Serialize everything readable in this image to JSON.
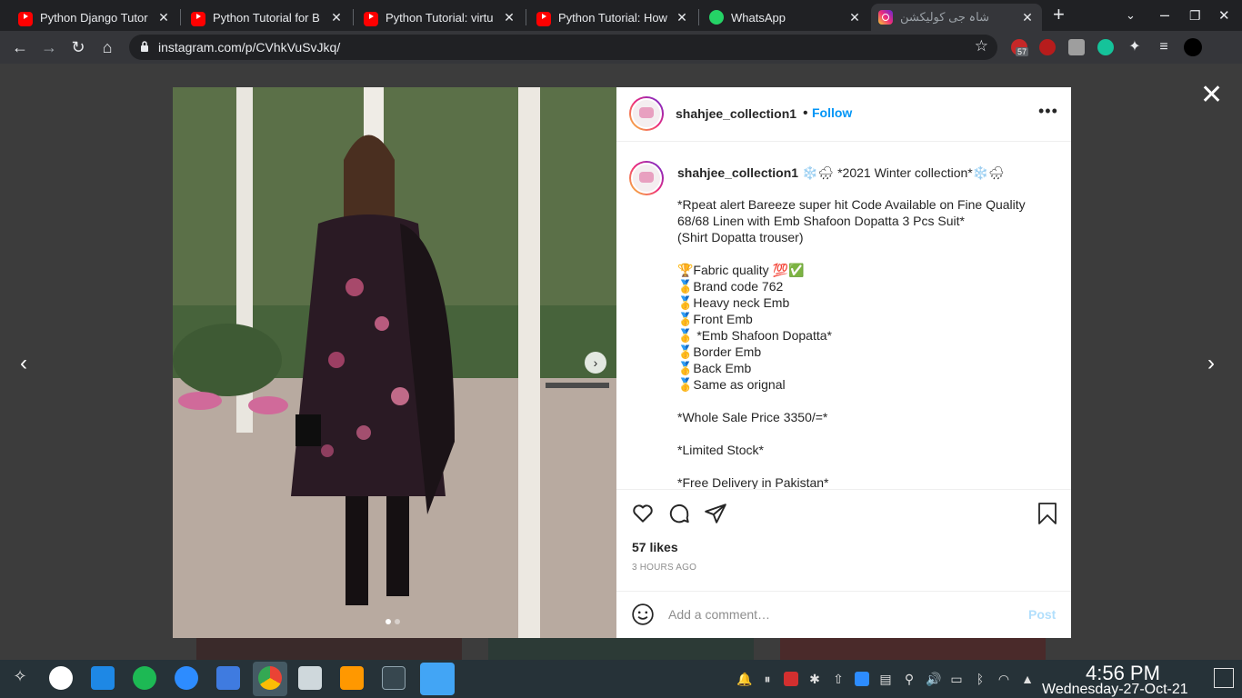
{
  "browser": {
    "tabs": [
      {
        "title": "Python Django Tutor",
        "icon": "youtube-icon"
      },
      {
        "title": "Python Tutorial for B",
        "icon": "youtube-icon"
      },
      {
        "title": "Python Tutorial: virtu",
        "icon": "youtube-icon"
      },
      {
        "title": "Python Tutorial: How",
        "icon": "youtube-icon"
      },
      {
        "title": "WhatsApp",
        "icon": "whatsapp-icon"
      },
      {
        "title": "شاہ جی کولیکشن",
        "icon": "instagram-icon"
      }
    ],
    "url": "instagram.com/p/CVhkVuSvJkq/",
    "ext_badge": "57",
    "colors": {
      "tabbar": "#202124",
      "toolbar": "#35363a"
    }
  },
  "post": {
    "username": "shahjee_collection1",
    "follow_label": "Follow",
    "more_label": "•••",
    "sep": "•",
    "caption_head_emoji": "❄️🌧 *2021 Winter collection*❄️🌧",
    "caption_lines": [
      "*Rpeat alert Bareeze super hit Code Available on Fine Quality",
      "68/68 Linen with Emb Shafoon Dopatta 3 Pcs Suit*",
      "(Shirt Dopatta trouser)",
      "",
      "🏆Fabric quality 💯✅",
      "🥇Brand code 762",
      "🥇Heavy neck Emb",
      "🥇Front Emb",
      "🥇 *Emb Shafoon Dopatta*",
      "🥇Border Emb",
      "🥇Back Emb",
      "🥇Same as orignal",
      "",
      "*Whole Sale Price 3350/=*",
      "",
      "*Limited Stock*",
      "",
      "*Free Delivery in Pakistan*"
    ],
    "likes": "57 likes",
    "time": "3 HOURS AGO",
    "comment_placeholder": "Add a comment…",
    "post_label": "Post"
  },
  "taskbar": {
    "time": "4:56 PM",
    "date": "Wednesday-27-Oct-21"
  }
}
